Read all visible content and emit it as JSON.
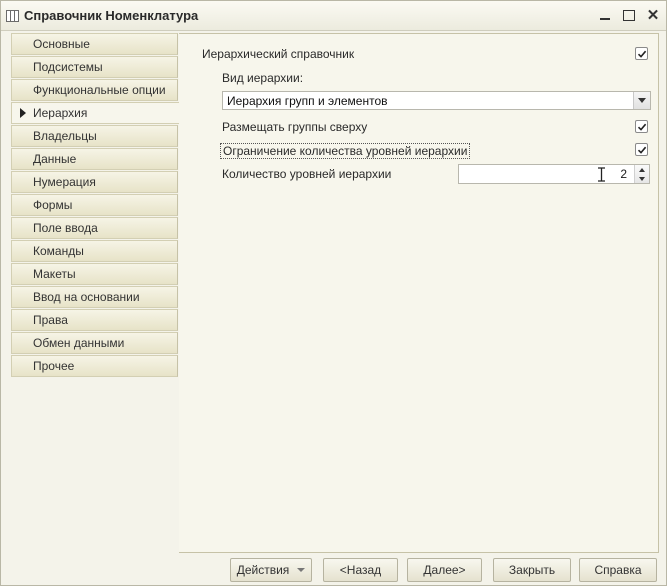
{
  "window": {
    "title": "Справочник Номенклатура"
  },
  "sidebar": {
    "items": [
      {
        "label": "Основные"
      },
      {
        "label": "Подсистемы"
      },
      {
        "label": "Функциональные опции"
      },
      {
        "label": "Иерархия",
        "active": true
      },
      {
        "label": "Владельцы"
      },
      {
        "label": "Данные"
      },
      {
        "label": "Нумерация"
      },
      {
        "label": "Формы"
      },
      {
        "label": "Поле ввода"
      },
      {
        "label": "Команды"
      },
      {
        "label": "Макеты"
      },
      {
        "label": "Ввод на основании"
      },
      {
        "label": "Права"
      },
      {
        "label": "Обмен данными"
      },
      {
        "label": "Прочее"
      }
    ]
  },
  "hierarchy": {
    "hierarchical_label": "Иерархический справочник",
    "hierarchical_checked": true,
    "hierarchy_type_label": "Вид иерархии:",
    "hierarchy_type_value": "Иерархия групп и элементов",
    "groups_on_top_label": "Размещать группы сверху",
    "groups_on_top_checked": true,
    "limit_levels_label": "Ограничение количества уровней иерархии",
    "limit_levels_checked": true,
    "levels_count_label": "Количество уровней иерархии",
    "levels_count_value": "2"
  },
  "footer": {
    "actions": "Действия",
    "back": "<Назад",
    "next": "Далее>",
    "close": "Закрыть",
    "help": "Справка"
  },
  "colors": {
    "background": "#f4f3ea",
    "tab": "#e7e3c8",
    "panel": "#f7f6ec"
  }
}
